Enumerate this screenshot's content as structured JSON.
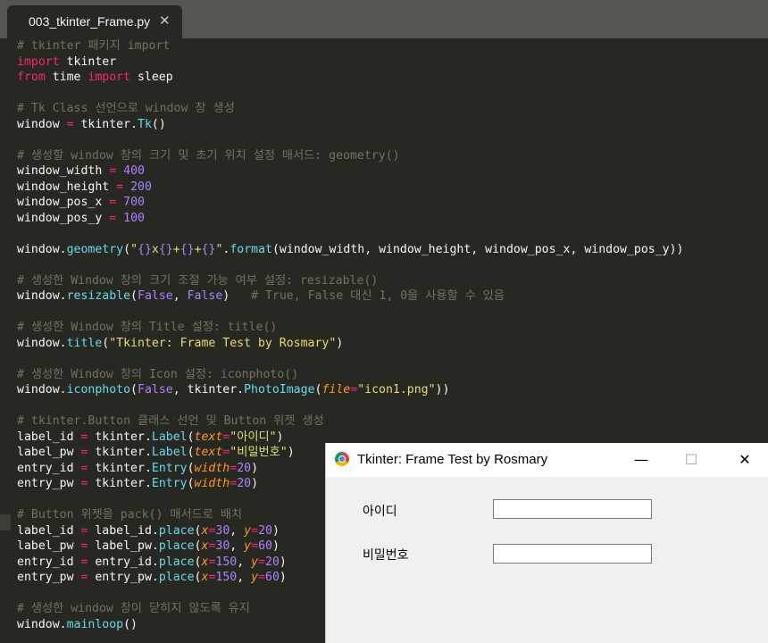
{
  "tab": {
    "title": "003_tkinter_Frame.py",
    "close": "✕"
  },
  "code": {
    "l1": {
      "a": "# tkinter 패키지 import"
    },
    "l2": {
      "a": "import",
      "b": " tkinter"
    },
    "l3": {
      "a": "from",
      "b": " time ",
      "c": "import",
      "d": " sleep"
    },
    "l5": {
      "a": "# Tk Class 선언으로 window 창 생성"
    },
    "l6": {
      "a": "window ",
      "b": "=",
      "c": " tkinter.",
      "d": "Tk",
      "e": "()"
    },
    "l8": {
      "a": "# 생성할 window 창의 크기 및 초기 위치 설정 매서드: geometry()"
    },
    "l9": {
      "a": "window_width ",
      "b": "=",
      "c": " ",
      "d": "400"
    },
    "l10": {
      "a": "window_height ",
      "b": "=",
      "c": " ",
      "d": "200"
    },
    "l11": {
      "a": "window_pos_x ",
      "b": "=",
      "c": " ",
      "d": "700"
    },
    "l12": {
      "a": "window_pos_y ",
      "b": "=",
      "c": " ",
      "d": "100"
    },
    "l14": {
      "a": "window.",
      "b": "geometry",
      "c": "(",
      "d": "\"",
      "e": "{}",
      "f": "x",
      "g": "{}",
      "h": "+",
      "i": "{}",
      "j": "+",
      "k": "{}",
      "l": "\"",
      "m": ".",
      "n": "format",
      "o": "(window_width, window_height, window_pos_x, window_pos_y))"
    },
    "l16": {
      "a": "# 생성한 Window 창의 크기 조절 가능 여부 설정: resizable()"
    },
    "l17": {
      "a": "window.",
      "b": "resizable",
      "c": "(",
      "d": "False",
      "e": ", ",
      "f": "False",
      "g": ")   ",
      "h": "# True, False 대신 1, 0을 사용할 수 있음"
    },
    "l19": {
      "a": "# 생성한 Window 창의 Title 설정: title()"
    },
    "l20": {
      "a": "window.",
      "b": "title",
      "c": "(",
      "d": "\"Tkinter: Frame Test by Rosmary\"",
      "e": ")"
    },
    "l22": {
      "a": "# 생성한 Window 창의 Icon 설정: iconphoto()"
    },
    "l23": {
      "a": "window.",
      "b": "iconphoto",
      "c": "(",
      "d": "False",
      "e": ", tkinter.",
      "f": "PhotoImage",
      "g": "(",
      "h": "file",
      "i": "=",
      "j": "\"icon1.png\"",
      "k": "))"
    },
    "l25": {
      "a": "# tkinter.Button 클래스 선언 및 Button 위젯 생성"
    },
    "l26": {
      "a": "label_id ",
      "b": "=",
      "c": " tkinter.",
      "d": "Label",
      "e": "(",
      "f": "text",
      "g": "=",
      "h": "\"아이디\"",
      "i": ")"
    },
    "l27": {
      "a": "label_pw ",
      "b": "=",
      "c": " tkinter.",
      "d": "Label",
      "e": "(",
      "f": "text",
      "g": "=",
      "h": "\"비밀번호\"",
      "i": ")"
    },
    "l28": {
      "a": "entry_id ",
      "b": "=",
      "c": " tkinter.",
      "d": "Entry",
      "e": "(",
      "f": "width",
      "g": "=",
      "h": "20",
      "i": ")"
    },
    "l29": {
      "a": "entry_pw ",
      "b": "=",
      "c": " tkinter.",
      "d": "Entry",
      "e": "(",
      "f": "width",
      "g": "=",
      "h": "20",
      "i": ")"
    },
    "l31": {
      "a": "# Button 위젯을 pack() 매서드로 배치"
    },
    "l32": {
      "a": "label_id ",
      "b": "=",
      "c": " label_id.",
      "d": "place",
      "e": "(",
      "f": "x",
      "g": "=",
      "h": "30",
      "i": ", ",
      "j": "y",
      "k": "=",
      "l": "20",
      "m": ")"
    },
    "l33": {
      "a": "label_pw ",
      "b": "=",
      "c": " label_pw.",
      "d": "place",
      "e": "(",
      "f": "x",
      "g": "=",
      "h": "30",
      "i": ", ",
      "j": "y",
      "k": "=",
      "l": "60",
      "m": ")"
    },
    "l34": {
      "a": "entry_id ",
      "b": "=",
      "c": " entry_id.",
      "d": "place",
      "e": "(",
      "f": "x",
      "g": "=",
      "h": "150",
      "i": ", ",
      "j": "y",
      "k": "=",
      "l": "20",
      "m": ")"
    },
    "l35": {
      "a": "entry_pw ",
      "b": "=",
      "c": " entry_pw.",
      "d": "place",
      "e": "(",
      "f": "x",
      "g": "=",
      "h": "150",
      "i": ", ",
      "j": "y",
      "k": "=",
      "l": "60",
      "m": ")"
    },
    "l37": {
      "a": "# 생성한 window 창이 닫히지 않도록 유지"
    },
    "l38": {
      "a": "window.",
      "b": "mainloop",
      "c": "()"
    }
  },
  "tk_window": {
    "title": "Tkinter: Frame Test by Rosmary",
    "minimize": "—",
    "maximize": "☐",
    "close": "✕",
    "label_id": "아이디",
    "label_pw": "비밀번호",
    "entry_id_value": "",
    "entry_pw_value": ""
  }
}
